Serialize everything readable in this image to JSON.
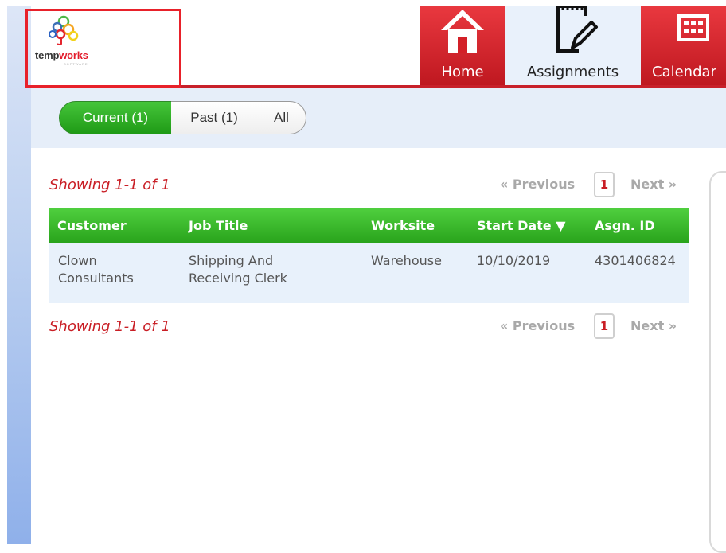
{
  "logo": {
    "word_a": "temp",
    "word_b": "works",
    "tagline": "SOFTWARE"
  },
  "nav": {
    "tabs": [
      {
        "label": "Home",
        "icon": "home-icon"
      },
      {
        "label": "Assignments",
        "icon": "notepad-pencil-icon"
      },
      {
        "label": "Calendar",
        "icon": "calendar-icon"
      }
    ]
  },
  "filter": {
    "options": [
      {
        "label": "Current (1)",
        "selected": true
      },
      {
        "label": "Past (1)",
        "selected": false
      },
      {
        "label": "All",
        "selected": false
      }
    ]
  },
  "pager_top": {
    "showing": "Showing 1-1 of 1",
    "prev": "« Previous",
    "page": "1",
    "next": "Next »"
  },
  "pager_bottom": {
    "showing": "Showing 1-1 of 1",
    "prev": "« Previous",
    "page": "1",
    "next": "Next »"
  },
  "table": {
    "columns": [
      "Customer",
      "Job Title",
      "Worksite",
      "Start Date ▼",
      "Asgn. ID"
    ],
    "rows": [
      {
        "customer": [
          "Clown",
          "Consultants"
        ],
        "job_title": [
          "Shipping And",
          "Receiving Clerk"
        ],
        "worksite": "Warehouse",
        "start_date": "10/10/2019",
        "asgn_id": "4301406824"
      }
    ]
  },
  "colors": {
    "accent_red": "#c8202a",
    "active_green": "#29a41c",
    "row_blue": "#e8f1fb"
  }
}
